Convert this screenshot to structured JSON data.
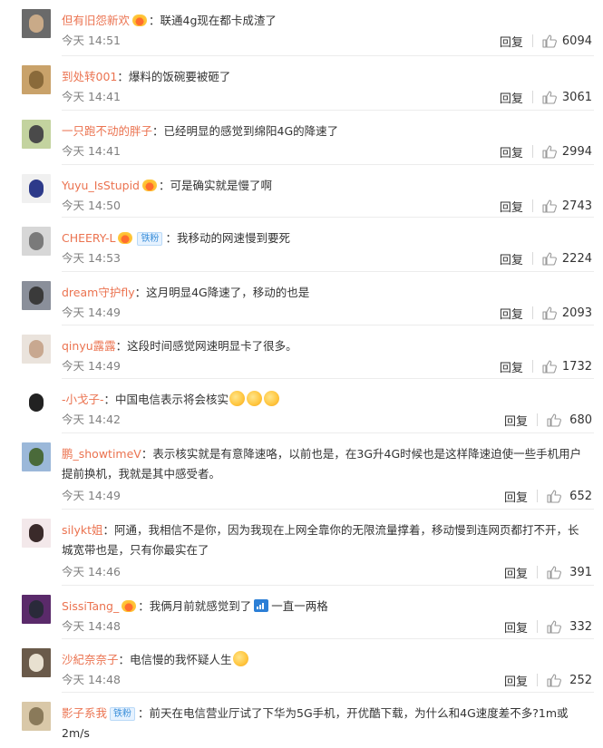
{
  "comments": [
    {
      "name": "但有旧怨新欢",
      "crown": true,
      "fan": false,
      "content": "：联通4g现在都卡成渣了",
      "time": "今天 14:51",
      "likes": "6094",
      "av": [
        "#6a6a6a",
        "#c9aa88"
      ]
    },
    {
      "name": "到处转001",
      "crown": false,
      "fan": false,
      "content": "：爆料的饭碗要被砸了",
      "time": "今天 14:41",
      "likes": "3061",
      "av": [
        "#c9a26a",
        "#8a6a3a"
      ]
    },
    {
      "name": "一只跑不动的胖子",
      "crown": false,
      "fan": false,
      "content": "：已经明显的感觉到绵阳4G的降速了",
      "time": "今天 14:41",
      "likes": "2994",
      "av": [
        "#c3d39f",
        "#4a4a4a"
      ]
    },
    {
      "name": "Yuyu_IsStupid",
      "crown": true,
      "fan": false,
      "content": "：可是确实就是慢了啊",
      "time": "今天 14:50",
      "likes": "2743",
      "av": [
        "#f0f0f0",
        "#2d3a8a"
      ]
    },
    {
      "name": "CHEERY-L",
      "crown": true,
      "fan": true,
      "content": "：我移动的网速慢到要死",
      "time": "今天 14:53",
      "likes": "2224",
      "av": [
        "#d7d7d7",
        "#7a7a7a"
      ]
    },
    {
      "name": "dream守护fly",
      "crown": false,
      "fan": false,
      "content": "：这月明显4G降速了，移动的也是",
      "time": "今天 14:49",
      "likes": "2093",
      "av": [
        "#8a8f9a",
        "#3a3a3a"
      ]
    },
    {
      "name": "qinyu露露",
      "crown": false,
      "fan": false,
      "content": "：这段时间感觉网速明显卡了很多。",
      "time": "今天 14:49",
      "likes": "1732",
      "av": [
        "#eae3dc",
        "#c8a890"
      ]
    },
    {
      "name": "-小戈子-",
      "crown": false,
      "fan": false,
      "content": "：中国电信表示将会核实",
      "emojis": 3,
      "time": "今天 14:42",
      "likes": "680",
      "av": [
        "#ffffff",
        "#222222"
      ]
    },
    {
      "name": "鹏_showtimeV",
      "crown": false,
      "fan": false,
      "content": "：表示核实就是有意降速咯，以前也是，在3G升4G时候也是这样降速迫使一些手机用户提前换机，我就是其中感受者。",
      "time": "今天 14:49",
      "likes": "652",
      "av": [
        "#9bb8d9",
        "#4a6a3a"
      ]
    },
    {
      "name": "silykt姐",
      "crown": false,
      "fan": false,
      "content": "：阿通，我相信不是你，因为我现在上网全靠你的无限流量撑着，移动慢到连网页都打不开，长城宽带也是，只有你最实在了",
      "time": "今天 14:46",
      "likes": "391",
      "av": [
        "#f3e8ea",
        "#3a2a2a"
      ]
    },
    {
      "name": "SissiTang_",
      "crown": true,
      "fan": false,
      "content": "：我俩月前就感觉到了",
      "signal": true,
      "content2": "一直一两格",
      "time": "今天 14:48",
      "likes": "332",
      "av": [
        "#5a2a6a",
        "#2a2a3a"
      ]
    },
    {
      "name": "沙紀奈奈子",
      "crown": false,
      "fan": false,
      "content": "：电信慢的我怀疑人生",
      "emojis": 1,
      "time": "今天 14:48",
      "likes": "252",
      "av": [
        "#6a5a4a",
        "#e8e0d0"
      ]
    },
    {
      "name": "影子系我",
      "crown": false,
      "fan": true,
      "content": "：前天在电信营业厅试了下华为5G手机，开优酷下载，为什么和4G速度差不多?1m或2m/s",
      "time": "",
      "likes": "",
      "av": [
        "#d9c8a8",
        "#8a7a5a"
      ]
    }
  ],
  "labels": {
    "reply": "回复",
    "fan_badge": "铁粉"
  },
  "colors": {
    "name": "#eb7350",
    "time": "#808080",
    "text": "#333333"
  },
  "icons": {
    "like": "thumbs-up-icon",
    "crown": "vip-crown-icon",
    "signal": "signal-icon",
    "emoji": "emoji-icon"
  }
}
